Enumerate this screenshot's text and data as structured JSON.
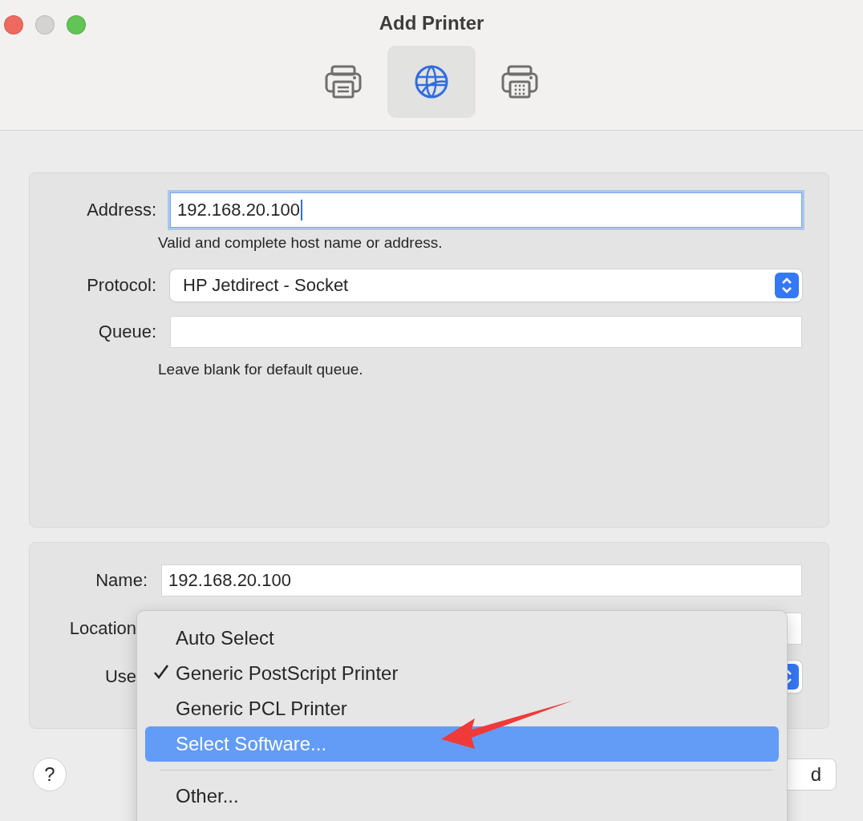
{
  "window": {
    "title": "Add Printer"
  },
  "toolbar": [
    {
      "kind": "default",
      "selected": false
    },
    {
      "kind": "ip",
      "selected": true
    },
    {
      "kind": "windows",
      "selected": false
    }
  ],
  "address_panel": {
    "rows": [
      {
        "kind": "input",
        "label": "Address:",
        "value": "192.168.20.100",
        "focused": true,
        "hint": "Valid and complete host name or address."
      },
      {
        "kind": "popup",
        "label": "Protocol:",
        "value": "HP Jetdirect - Socket"
      },
      {
        "kind": "input",
        "label": "Queue:",
        "value": "",
        "focused": false,
        "hint": "Leave blank for default queue."
      }
    ]
  },
  "info_panel": {
    "rows": [
      {
        "kind": "input",
        "label": "Name:",
        "value": "192.168.20.100",
        "covered": false
      },
      {
        "kind": "input",
        "label": "Location",
        "value": "",
        "covered": true
      },
      {
        "kind": "popup",
        "label": "Use",
        "value": "",
        "covered": true
      }
    ]
  },
  "help_button": {
    "label": "?"
  },
  "add_button": {
    "label": "d"
  },
  "menu": {
    "items": [
      {
        "kind": "option",
        "label": "Auto Select",
        "checked": false,
        "selected": false
      },
      {
        "kind": "option",
        "label": "Generic PostScript Printer",
        "checked": true,
        "selected": false
      },
      {
        "kind": "option",
        "label": "Generic PCL Printer",
        "checked": false,
        "selected": false
      },
      {
        "kind": "option",
        "label": "Select Software...",
        "checked": false,
        "selected": true
      },
      {
        "kind": "separator"
      },
      {
        "kind": "option",
        "label": "Other...",
        "checked": false,
        "selected": false
      }
    ]
  },
  "annotation": {
    "kind": "arrow",
    "color": "#f03a3a"
  }
}
